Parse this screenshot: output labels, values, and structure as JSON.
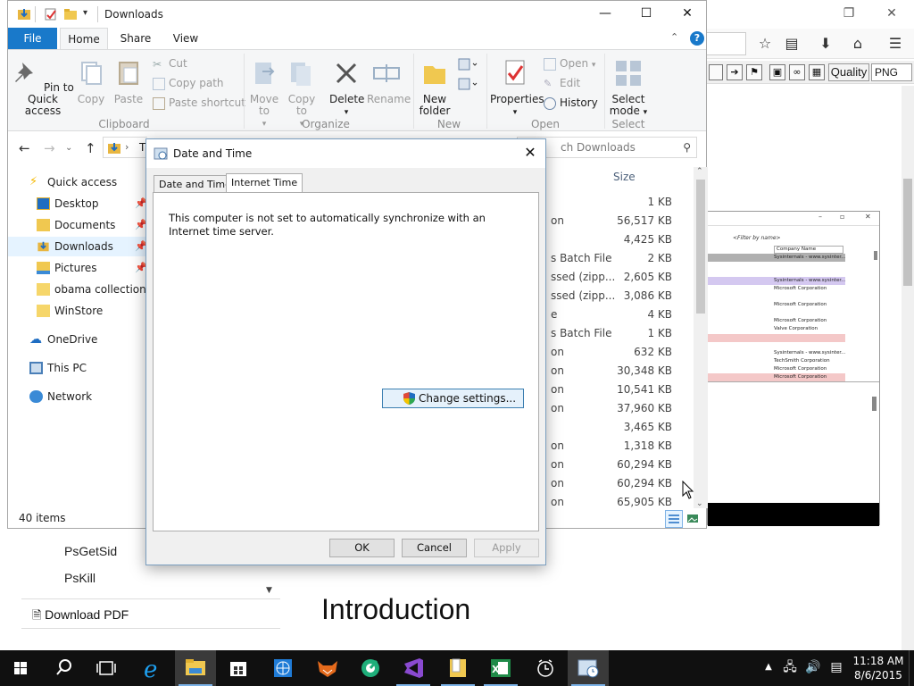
{
  "browser": {
    "toolbar": {
      "quality_label": "Quality",
      "format_value": "PNG"
    },
    "embedded_image": {
      "filter_placeholder": "<Filter by name>",
      "column_header": "Company Name",
      "rows": [
        "Sysinternals - www.sysinter...",
        "Sysinternals - www.sysinter...",
        "Microsoft Corporation",
        "Microsoft Corporation",
        "Microsoft Corporation",
        "Valve Corporation",
        "Sysinternals - www.sysinter...",
        "TechSmith Corporation",
        "Microsoft Corporation",
        "Microsoft Corporation"
      ]
    },
    "page": {
      "sidebar_links": [
        "PsGetSid",
        "PsKill"
      ],
      "download_label": "Download PDF",
      "heading": "Introduction"
    }
  },
  "explorer": {
    "title": "Downloads",
    "tabs": {
      "file": "File",
      "home": "Home",
      "share": "Share",
      "view": "View"
    },
    "ribbon": {
      "clipboard": {
        "label": "Clipboard",
        "pin": "Pin to Quick access",
        "copy": "Copy",
        "paste": "Paste",
        "cut": "Cut",
        "copy_path": "Copy path",
        "paste_shortcut": "Paste shortcut"
      },
      "organize": {
        "label": "Organize",
        "move_to": "Move to",
        "copy_to": "Copy to",
        "delete": "Delete",
        "rename": "Rename"
      },
      "new": {
        "label": "New",
        "new_folder": "New folder"
      },
      "open": {
        "label": "Open",
        "properties": "Properties",
        "open": "Open",
        "edit": "Edit",
        "history": "History"
      },
      "select": {
        "label": "Select",
        "select_mode": "Select mode"
      }
    },
    "address": {
      "path_fragment": "T",
      "search_placeholder": "ch Downloads"
    },
    "nav": {
      "quick_access": "Quick access",
      "items": [
        {
          "label": "Desktop",
          "pinned": true
        },
        {
          "label": "Documents",
          "pinned": true
        },
        {
          "label": "Downloads",
          "pinned": true
        },
        {
          "label": "Pictures",
          "pinned": true
        },
        {
          "label": "obama collection",
          "pinned": false
        },
        {
          "label": "WinStore",
          "pinned": false
        }
      ],
      "onedrive": "OneDrive",
      "this_pc": "This PC",
      "network": "Network"
    },
    "file_list": {
      "size_header": "Size",
      "rows": [
        {
          "type": "",
          "size": "1 KB"
        },
        {
          "type": "on",
          "size": "56,517 KB"
        },
        {
          "type": "",
          "size": "4,425 KB"
        },
        {
          "type": "s Batch File",
          "size": "2 KB"
        },
        {
          "type": "ssed (zipp...",
          "size": "2,605 KB"
        },
        {
          "type": "ssed (zipp...",
          "size": "3,086 KB"
        },
        {
          "type": "e",
          "size": "4 KB"
        },
        {
          "type": "s Batch File",
          "size": "1 KB"
        },
        {
          "type": "on",
          "size": "632 KB"
        },
        {
          "type": "on",
          "size": "30,348 KB"
        },
        {
          "type": "on",
          "size": "10,541 KB"
        },
        {
          "type": "on",
          "size": "37,960 KB"
        },
        {
          "type": "",
          "size": "3,465 KB"
        },
        {
          "type": "on",
          "size": "1,318 KB"
        },
        {
          "type": "on",
          "size": "60,294 KB"
        },
        {
          "type": "on",
          "size": "60,294 KB"
        },
        {
          "type": "on",
          "size": "65,905 KB"
        }
      ]
    },
    "status": "40 items"
  },
  "dialog": {
    "title": "Date and Time",
    "tabs": {
      "date_time": "Date and Time",
      "internet_time": "Internet Time"
    },
    "message": "This computer is not set to automatically synchronize with an Internet time server.",
    "change_settings": "Change settings...",
    "ok": "OK",
    "cancel": "Cancel",
    "apply": "Apply"
  },
  "taskbar": {
    "apps": [
      "start-icon",
      "search-icon",
      "task-view-icon",
      "edge-icon",
      "file-explorer-icon",
      "store-icon",
      "globe-app-icon",
      "fox-app-icon",
      "green-circle-app-icon",
      "visual-studio-icon",
      "explorer-folder-icon",
      "excel-icon",
      "alarms-icon",
      "date-time-control-panel-icon"
    ],
    "time": "11:18 AM",
    "date": "8/6/2015"
  },
  "colors": {
    "file_tab": "#1979ca",
    "selected_nav": "#e5f3ff",
    "taskbar": "#101010",
    "dialog_border": "#7a9ebf"
  }
}
